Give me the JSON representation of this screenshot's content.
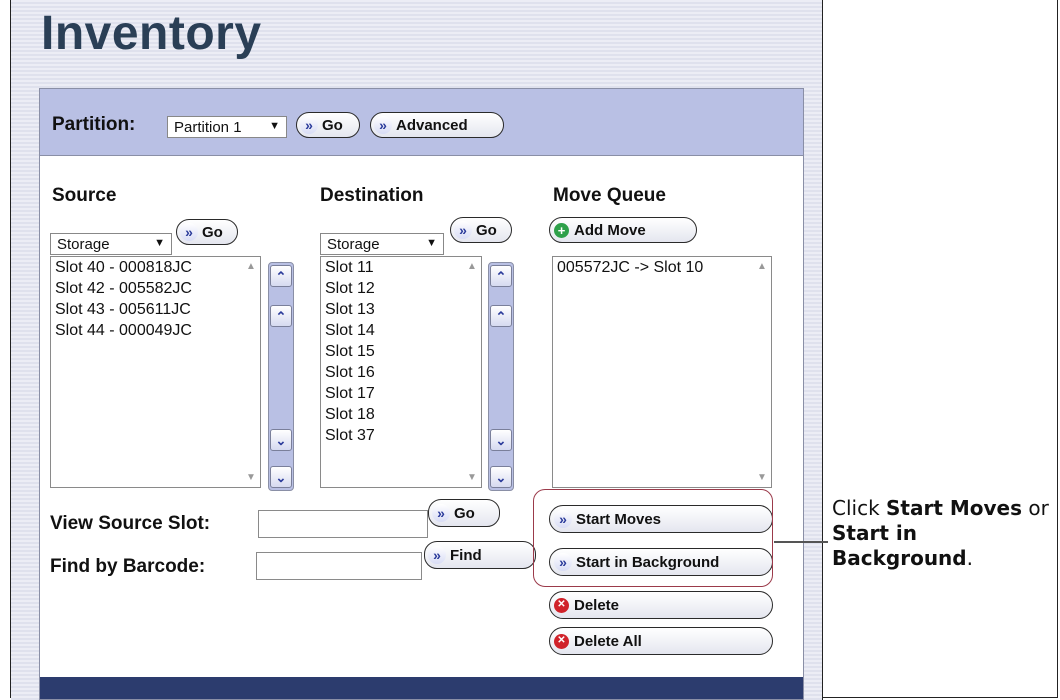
{
  "page_title": "Inventory",
  "partition": {
    "label": "Partition:",
    "selected": "Partition 1",
    "go_label": "Go",
    "advanced_label": "Advanced"
  },
  "source": {
    "header": "Source",
    "type_selected": "Storage",
    "go_label": "Go",
    "items": [
      "Slot 40 - 000818JC",
      "Slot 42 - 005582JC",
      "Slot 43 - 005611JC",
      "Slot 44 - 000049JC"
    ]
  },
  "destination": {
    "header": "Destination",
    "type_selected": "Storage",
    "go_label": "Go",
    "items": [
      "Slot 11",
      "Slot 12",
      "Slot 13",
      "Slot 14",
      "Slot 15",
      "Slot 16",
      "Slot 17",
      "Slot 18",
      "Slot 37"
    ]
  },
  "move_queue": {
    "header": "Move Queue",
    "add_move_label": "Add Move",
    "items": [
      "005572JC -> Slot 10"
    ],
    "start_moves_label": "Start Moves",
    "start_background_label": "Start in Background",
    "delete_label": "Delete",
    "delete_all_label": "Delete All"
  },
  "view_source": {
    "label": "View Source Slot:",
    "value": "",
    "go_label": "Go"
  },
  "find_barcode": {
    "label": "Find by Barcode:",
    "value": "",
    "find_label": "Find"
  },
  "callout": {
    "prefix": "Click ",
    "start_moves": "Start Moves",
    "middle": " or ",
    "start_in": "Start in Background",
    "suffix": "."
  },
  "icons": {
    "double-chevron-right": "»",
    "double-chevron-up": "⌃⌃",
    "chevron-up": "^",
    "chevron-down": "v",
    "double-chevron-down": "vv",
    "add": "+",
    "delete": "x",
    "dropdown": "▼"
  },
  "colors": {
    "title": "#2a3f56",
    "panel_bar": "#b9c0e4",
    "bottom_bar": "#2c3c6e",
    "callout_border": "#9b3a4a"
  }
}
